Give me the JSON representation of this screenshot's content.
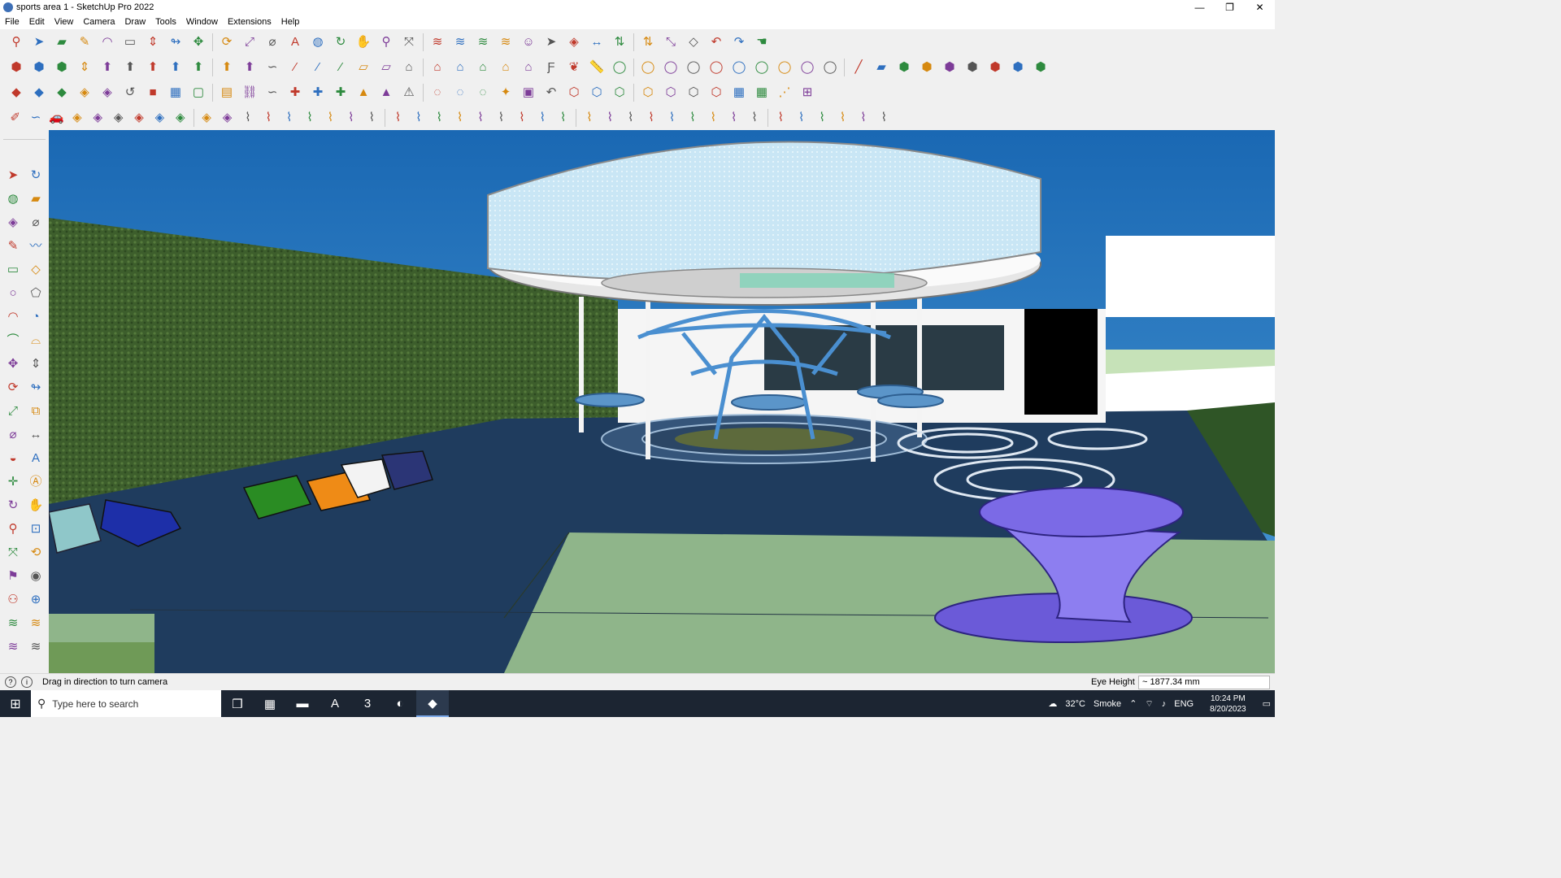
{
  "window": {
    "title": "sports area 1 - SketchUp Pro 2022",
    "minimize_label": "—",
    "restore_label": "❐",
    "close_label": "✕"
  },
  "menu": [
    "File",
    "Edit",
    "View",
    "Camera",
    "Draw",
    "Tools",
    "Window",
    "Extensions",
    "Help"
  ],
  "toolbars": {
    "row1": [
      "search-icon",
      "select-arrow-icon",
      "eraser-icon",
      "line-pencil-icon",
      "arc-icon",
      "rectangle-icon",
      "push-pull-icon",
      "follow-me-icon",
      "move-icon",
      "rotate-icon",
      "scale-icon",
      "tape-measure-icon",
      "text-icon",
      "paint-bucket-icon",
      "orbit-icon",
      "pan-icon",
      "zoom-icon",
      "zoom-extents-icon",
      "sandbox-icon",
      "sandbox-icon",
      "sandbox-icon",
      "sandbox-icon",
      "user-account-icon",
      "select-tool-icon",
      "component-icon",
      "dimension-icon",
      "section-icon",
      "section-icon",
      "transform-icon",
      "view-icon",
      "undo-icon",
      "redo-icon",
      "hand-icon"
    ],
    "row2": [
      "box-3d-icon",
      "box-3d-icon",
      "box-3d-icon",
      "push-pull-icon",
      "extrude-icon",
      "extrude-icon",
      "extrude-icon",
      "extrude-icon",
      "extrude-icon",
      "extrude-icon",
      "extrude-icon",
      "curve-icon",
      "slash-icon",
      "slash-icon",
      "slash-icon",
      "plane-icon",
      "plane-icon",
      "house-icon",
      "house-icon",
      "house-icon",
      "house-icon",
      "house-icon",
      "house-icon",
      "font-icon",
      "leaf-icon",
      "ruler-icon",
      "shape-icon",
      "shape-icon",
      "shape-icon",
      "shape-icon",
      "shape-icon",
      "shape-icon",
      "shape-icon",
      "shape-icon",
      "shape-icon",
      "shape-icon",
      "line-tool-icon",
      "eraser-icon",
      "box-3d-icon",
      "box-3d-icon",
      "box-3d-icon",
      "box-3d-icon",
      "box-3d-icon",
      "box-3d-icon",
      "box-3d-icon"
    ],
    "row3": [
      "solid-icon",
      "solid-icon",
      "solid-icon",
      "component-icon",
      "component-icon",
      "circle-arrow-icon",
      "red-square-icon",
      "grid-icon",
      "page-icon",
      "wood-icon",
      "chain-icon",
      "curve-icon",
      "cross-icon",
      "cross-icon",
      "cross-icon",
      "cone-icon",
      "cone-icon",
      "warning-icon",
      "lasso-icon",
      "lasso-icon",
      "lasso-icon",
      "star-icon",
      "cube-icon",
      "undo-icon",
      "shapes-icon",
      "shapes-icon",
      "shapes-icon",
      "shapes-icon",
      "shapes-icon",
      "shapes-icon",
      "shapes-icon",
      "grid-icon",
      "grid-icon",
      "dotted-curve-icon",
      "align-icon"
    ],
    "row4": [
      "draw-icon",
      "curve-icon",
      "car-icon",
      "component-icon",
      "component-icon",
      "component-icon",
      "component-icon",
      "component-icon",
      "component-icon",
      "component-icon",
      "component-icon",
      "stair-icon",
      "stair-icon",
      "stair-icon",
      "stair-icon",
      "stair-icon",
      "stair-icon",
      "stair-icon",
      "stair-icon",
      "stair-icon",
      "stair-icon",
      "stair-icon",
      "stair-icon",
      "stair-icon",
      "stair-icon",
      "stair-icon",
      "stair-icon",
      "stair-icon",
      "stair-icon",
      "stair-icon",
      "stair-icon",
      "stair-icon",
      "stair-icon",
      "stair-icon",
      "stair-icon",
      "stair-icon",
      "stair-icon",
      "stair-icon",
      "stair-icon",
      "stair-icon",
      "stair-icon",
      "stair-icon"
    ]
  },
  "left_tools": [
    "select-arrow-icon",
    "orbit-icon",
    "paint-bucket-icon",
    "eraser-icon",
    "component-icon",
    "tape-measure-icon",
    "line-pencil-icon",
    "freehand-icon",
    "rectangle-icon",
    "rotated-rectangle-icon",
    "circle-icon",
    "polygon-icon",
    "arc-icon",
    "pie-icon",
    "arc-3pt-icon",
    "arc-2pt-icon",
    "move-icon",
    "push-pull-icon",
    "rotate-icon",
    "follow-me-icon",
    "scale-icon",
    "offset-icon",
    "tape-measure-icon",
    "dimension-icon",
    "protractor-icon",
    "text-icon",
    "axes-icon",
    "3d-text-icon",
    "orbit-icon",
    "pan-icon",
    "zoom-icon",
    "zoom-window-icon",
    "zoom-extents-icon",
    "previous-view-icon",
    "position-camera-icon",
    "look-around-icon",
    "walk-icon",
    "section-plane-icon",
    "sandbox-icon",
    "sandbox-icon",
    "sandbox-icon",
    "sandbox-icon"
  ],
  "status": {
    "hint": "Drag in direction to turn camera",
    "eye_height_label": "Eye Height",
    "eye_height_value": "~ 1877.34 mm"
  },
  "taskbar": {
    "search_placeholder": "Type here to search",
    "weather_temp": "32°C",
    "weather_text": "Smoke",
    "language": "ENG",
    "time": "10:24 PM",
    "date": "8/20/2023"
  },
  "colors": {
    "toolbar_bg": "#f0f0f0",
    "taskbar_bg": "#1c2532",
    "sky": "#1a70b8",
    "hedge": "#3d5e2c",
    "floor": "#1f3c5e",
    "lawn": "#8fb58a"
  }
}
